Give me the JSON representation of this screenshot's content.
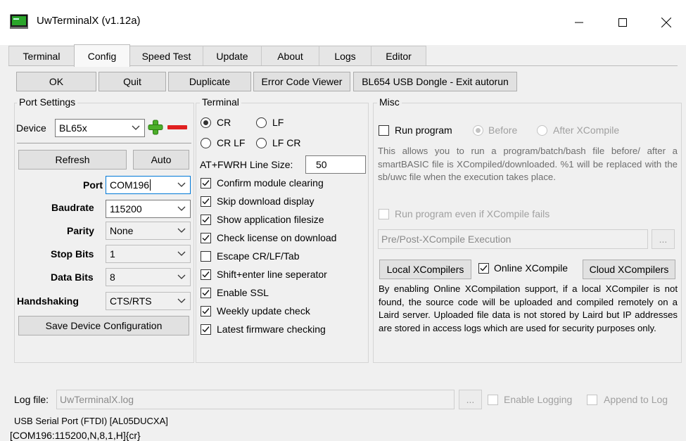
{
  "window": {
    "title": "UwTerminalX (v1.12a)",
    "controls": {
      "minimize": "—",
      "maximize": "☐",
      "close": "✕"
    }
  },
  "tabs": [
    {
      "label": "Terminal",
      "key": "T"
    },
    {
      "label": "Config",
      "key": ""
    },
    {
      "label": "Speed Test",
      "key": "p"
    },
    {
      "label": "Update",
      "key": "p"
    },
    {
      "label": "About",
      "key": "u"
    },
    {
      "label": "Logs",
      "key": "g"
    },
    {
      "label": "Editor",
      "key": ""
    }
  ],
  "active_tab": "Config",
  "toolbar": {
    "ok": "OK",
    "quit": "Quit",
    "duplicate": "Duplicate",
    "error_code_viewer": "Error Code Viewer",
    "autorun": "BL654 USB Dongle - Exit autorun"
  },
  "port_settings": {
    "title": "Port Settings",
    "device_label": "Device",
    "device_value": "BL65x",
    "refresh": "Refresh",
    "auto": "Auto",
    "port_label": "Port",
    "port_value": "COM196",
    "baudrate_label": "Baudrate",
    "baudrate_value": "115200",
    "parity_label": "Parity",
    "parity_value": "None",
    "stopbits_label": "Stop Bits",
    "stopbits_value": "1",
    "databits_label": "Data Bits",
    "databits_value": "8",
    "handshaking_label": "Handshaking",
    "handshaking_value": "CTS/RTS",
    "save": "Save Device Configuration"
  },
  "terminal": {
    "title": "Terminal",
    "radio_cr": "CR",
    "radio_lf": "LF",
    "radio_crlf": "CR LF",
    "radio_lfcr": "LF CR",
    "selected_line_ending": "CR",
    "line_size_label": "AT+FWRH Line Size:",
    "line_size_value": "50",
    "options": [
      {
        "label": "Confirm module clearing",
        "checked": true
      },
      {
        "label": "Skip download display",
        "checked": true
      },
      {
        "label": "Show application filesize",
        "checked": true
      },
      {
        "label": "Check license on download",
        "checked": true
      },
      {
        "label": "Escape CR/LF/Tab",
        "checked": false
      },
      {
        "label": "Shift+enter line seperator",
        "checked": true
      },
      {
        "label": "Enable SSL",
        "checked": true
      },
      {
        "label": "Weekly update check",
        "checked": true
      },
      {
        "label": "Latest firmware checking",
        "checked": true
      }
    ]
  },
  "misc": {
    "title": "Misc",
    "run_program": "Run program",
    "before": "Before",
    "after": "After XCompile",
    "run_description": "This allows you to run a program/batch/bash file before/ after a smartBASIC file is XCompiled/downloaded. %1 will be replaced with the sb/uwc file when the execution takes place.",
    "run_even_if_fails": "Run program even if XCompile fails",
    "execution_placeholder": "Pre/Post-XCompile Execution",
    "browse": "...",
    "local_xcompilers": "Local XCompilers",
    "online_xcompile": "Online XCompile",
    "online_xcompile_checked": true,
    "cloud_xcompilers": "Cloud XCompilers",
    "online_description": "By enabling Online XCompilation support, if a local XCompiler is not found, the source code will be uploaded and compiled remotely on a Laird server. Uploaded file data is not stored by Laird but IP addresses are stored in access logs which are used for security purposes only."
  },
  "log": {
    "label": "Log file:",
    "value": "UwTerminalX.log",
    "browse": "...",
    "enable_logging": "Enable Logging",
    "append_to_log": "Append to Log"
  },
  "device_info": "USB Serial Port (FTDI) [AL05DUCXA]",
  "status_bar": "[COM196:115200,N,8,1,H]{cr}",
  "colors": {
    "window_bg": "#f0f0f0",
    "titlebar_bg": "#ffffff",
    "plus_green": "#4caf2a",
    "minus_red": "#e02020"
  }
}
